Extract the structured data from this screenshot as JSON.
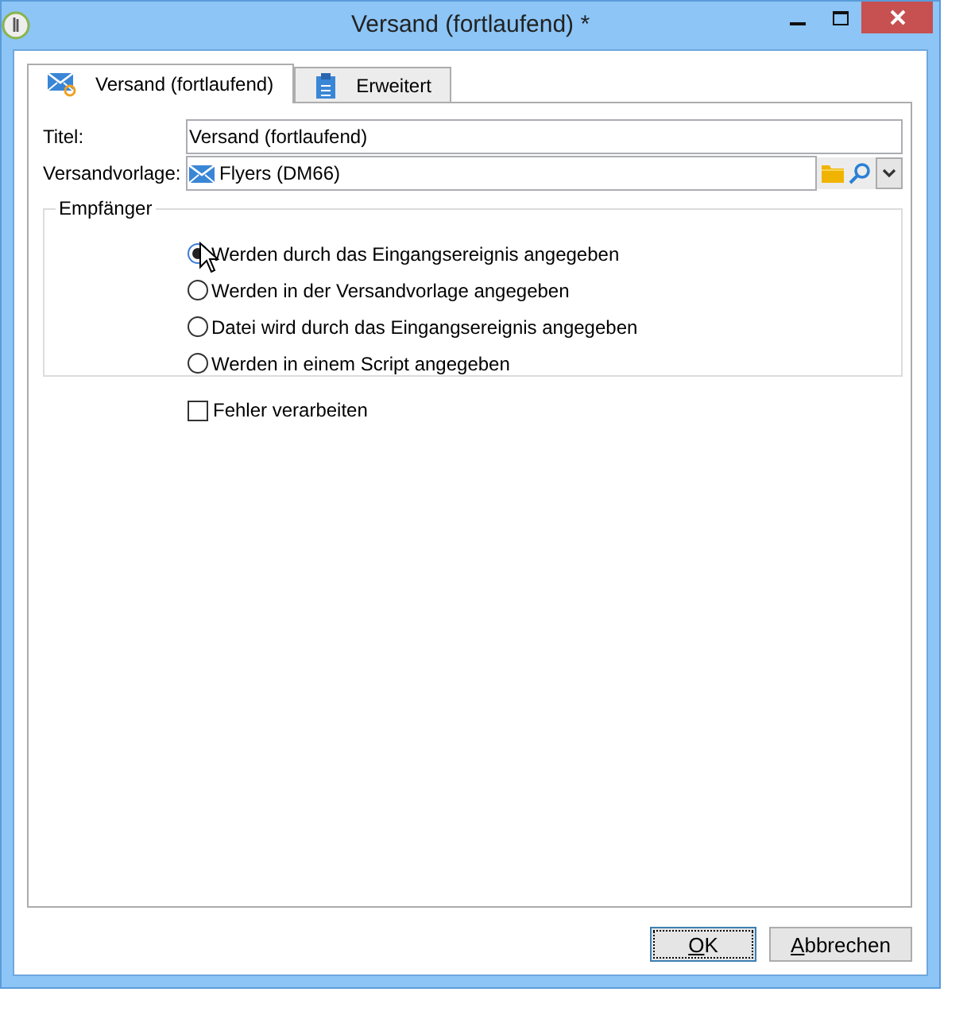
{
  "window": {
    "title": "Versand (fortlaufend) *"
  },
  "tabs": [
    {
      "label": "Versand (fortlaufend)",
      "selected": true
    },
    {
      "label": "Erweitert",
      "selected": false
    }
  ],
  "fields": [
    {
      "kind": "text",
      "label": "Titel:",
      "value": "Versand (fortlaufend)"
    },
    {
      "kind": "picker",
      "label": "Versandvorlage:",
      "value": "Flyers (DM66)"
    }
  ],
  "recipients": {
    "legend": "Empfänger",
    "options": [
      {
        "label": "Werden durch das Eingangsereignis angegeben",
        "selected": true
      },
      {
        "label": "Werden in der Versandvorlage angegeben",
        "selected": false
      },
      {
        "label": "Datei wird durch das Eingangsereignis angegeben",
        "selected": false
      },
      {
        "label": "Werden in einem Script angegeben",
        "selected": false
      }
    ]
  },
  "checkbox": {
    "label": "Fehler verarbeiten",
    "checked": false
  },
  "buttons": [
    {
      "key": "O",
      "after": "K",
      "default": true
    },
    {
      "key": "A",
      "after": "bbrechen",
      "default": false
    }
  ]
}
